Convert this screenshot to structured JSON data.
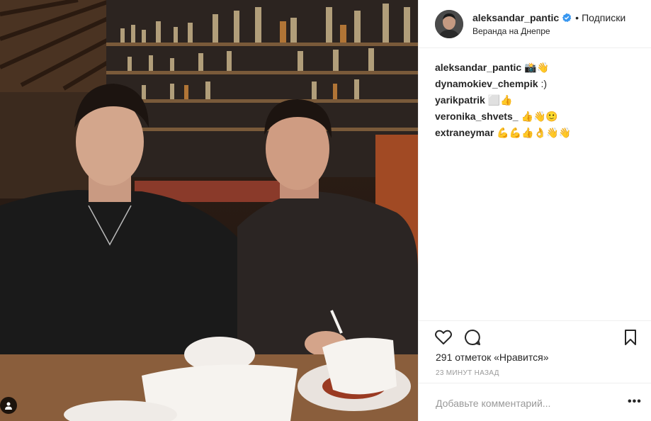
{
  "post": {
    "photo_description_icon": "post-photo",
    "tag_icon": "user-tag-icon"
  },
  "header": {
    "username": "aleksandar_pantic",
    "separator": "•",
    "follow_label": "Подписки",
    "location": "Веранда на Днепре",
    "verified_color": "#3897f0"
  },
  "comments": [
    {
      "author": "aleksandar_pantic",
      "text": "📸👋"
    },
    {
      "author": "dynamokiev_chempik",
      "text": ":)"
    },
    {
      "author": "yarikpatrik",
      "text": "⬜👍"
    },
    {
      "author": "veronika_shvets_",
      "text": "👍👋🙂"
    },
    {
      "author": "extraneymar",
      "text": "💪💪👍👌👋👋"
    }
  ],
  "actions": {
    "like_icon": "heart-icon",
    "comment_icon": "comment-icon",
    "save_icon": "bookmark-icon"
  },
  "likes": "291 отметок «Нравится»",
  "timestamp": "23 МИНУТ НАЗАД",
  "add_comment": {
    "placeholder": "Добавьте комментарий..."
  },
  "more_label": "•••",
  "colors": {
    "text": "#262626",
    "muted": "#999999",
    "border": "#efefef",
    "accent": "#3897f0"
  }
}
